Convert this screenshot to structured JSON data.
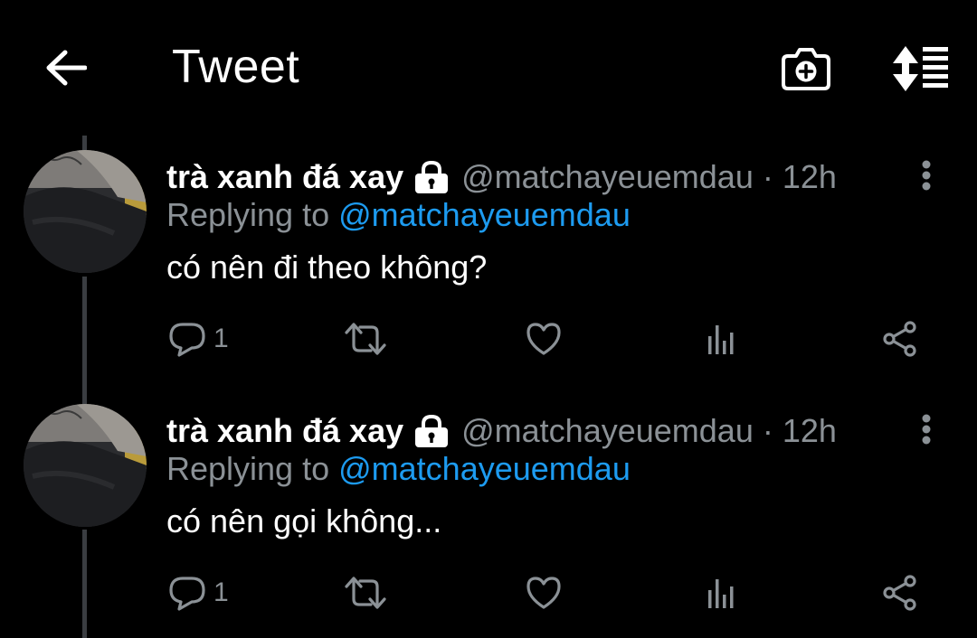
{
  "header": {
    "title": "Tweet",
    "back_icon": "arrow-left-icon",
    "camera_icon": "camera-add-icon",
    "sort_icon": "sort-icon"
  },
  "colors": {
    "background": "#000000",
    "primary_text": "#ffffff",
    "secondary_text": "#8b9196",
    "link": "#1d9bf0",
    "thread_line": "#3a3d41"
  },
  "tweets": [
    {
      "display_name": "trà xanh đá xay",
      "protected_icon": "lock-icon",
      "handle": "@matchayeuemdau",
      "separator": "·",
      "time": "12h",
      "replying_label": "Replying to",
      "replying_to": "@matchayeuemdau",
      "text": "có nên đi theo không?",
      "reply_count": "1",
      "actions": [
        "reply-icon",
        "retweet-icon",
        "like-icon",
        "analytics-icon",
        "share-icon"
      ]
    },
    {
      "display_name": "trà xanh đá xay",
      "protected_icon": "lock-icon",
      "handle": "@matchayeuemdau",
      "separator": "·",
      "time": "12h",
      "replying_label": "Replying to",
      "replying_to": "@matchayeuemdau",
      "text": "có nên gọi không...",
      "reply_count": "1",
      "actions": [
        "reply-icon",
        "retweet-icon",
        "like-icon",
        "analytics-icon",
        "share-icon"
      ]
    }
  ]
}
